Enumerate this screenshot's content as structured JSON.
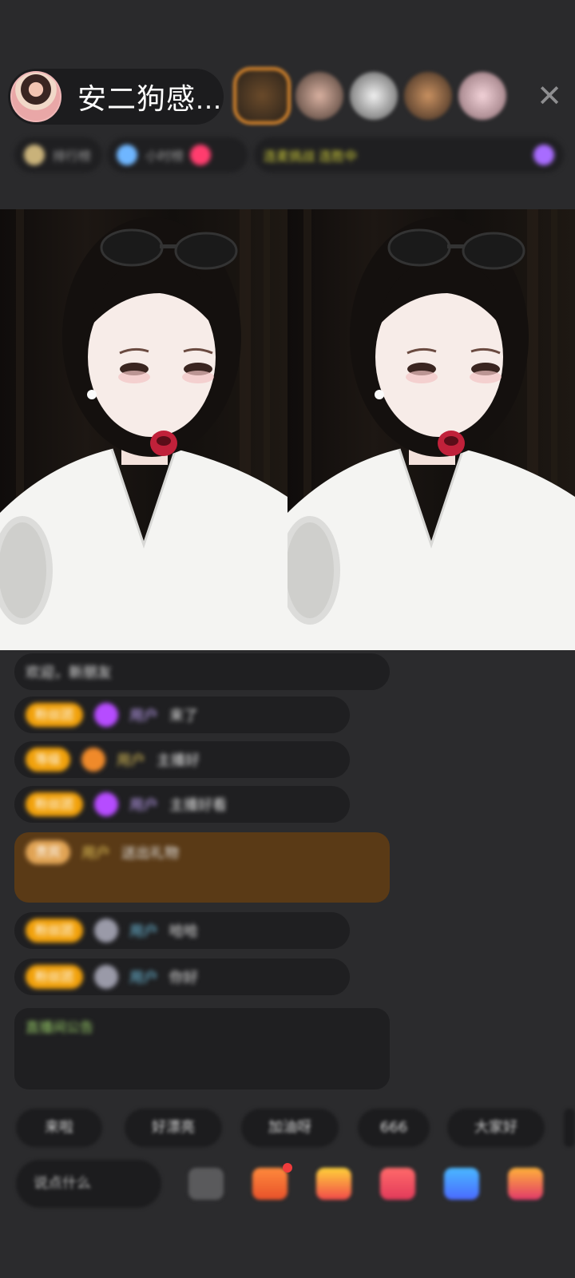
{
  "header": {
    "host_name": "安二狗感...",
    "close_icon": "close-icon",
    "viewer_count_avatars": 5
  },
  "info_strip": {
    "chips": [
      {
        "label": "排行榜",
        "icon": "rank-icon"
      },
      {
        "label": "小时榜",
        "icon": "hourly-rank-icon"
      },
      {
        "label": "连麦挑战 连胜中",
        "icon": "challenge-icon"
      }
    ]
  },
  "chat": {
    "messages": [
      {
        "badge": "",
        "user": "",
        "text": "欢迎，新朋友"
      },
      {
        "badge": "粉丝团",
        "user": "用户",
        "text": "来了"
      },
      {
        "badge": "等级",
        "user": "用户",
        "text": "主播好"
      },
      {
        "badge": "粉丝团",
        "user": "用户",
        "text": "主播好看"
      },
      {
        "badge": "贵宾",
        "user": "用户",
        "text": "送出礼物"
      },
      {
        "badge": "粉丝团",
        "user": "用户",
        "text": "哈哈"
      },
      {
        "badge": "粉丝团",
        "user": "用户",
        "text": "你好"
      },
      {
        "badge": "",
        "user": "",
        "text": "直播间公告"
      }
    ]
  },
  "quick_replies": [
    "来啦",
    "好漂亮",
    "加油呀",
    "666",
    "大家好"
  ],
  "bottom_bar": {
    "say_placeholder": "说点什么",
    "tools": [
      "emoji-icon",
      "gift-box-icon",
      "gift-icon",
      "lucky-bag-icon",
      "game-icon",
      "more-icon"
    ]
  },
  "colors": {
    "background": "#2b2b2d",
    "badge_orange": "#f2a20c",
    "rich_message_bg": "#5a3a16",
    "notice_green": "#9cd36a"
  }
}
